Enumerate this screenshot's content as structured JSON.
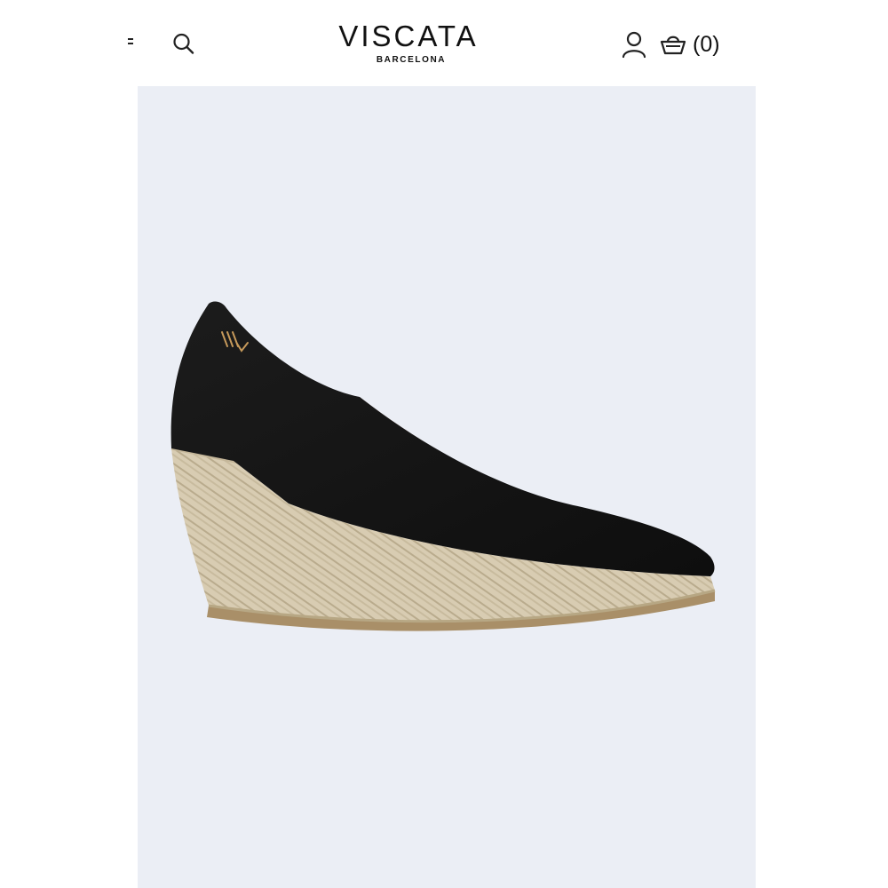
{
  "header": {
    "logo_main": "VISCATA",
    "logo_sub": "BARCELONA",
    "cart_count": "(0)"
  },
  "icons": {
    "menu": "menu-icon",
    "search": "search-icon",
    "account": "user-icon",
    "cart": "basket-icon"
  },
  "colors": {
    "panel_background": "#ebeef5",
    "shoe_upper": "#161616",
    "jute_sole": "#d6cab0",
    "logo_stitch": "#c79a5b"
  }
}
